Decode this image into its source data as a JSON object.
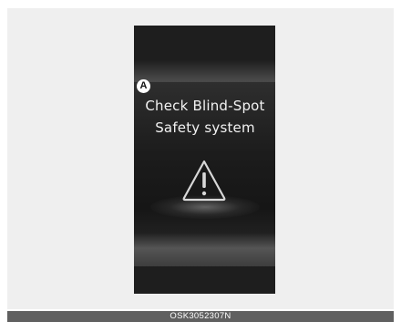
{
  "callout": {
    "label": "A"
  },
  "message": {
    "line1": "Check Blind-Spot",
    "line2": "Safety system"
  },
  "icon": {
    "name": "warning-triangle-icon"
  },
  "figure": {
    "code": "OSK3052307N"
  },
  "colors": {
    "background": "#efefef",
    "display": "#1e1e1e",
    "text": "#f2f2f2",
    "footer": "#606060"
  }
}
